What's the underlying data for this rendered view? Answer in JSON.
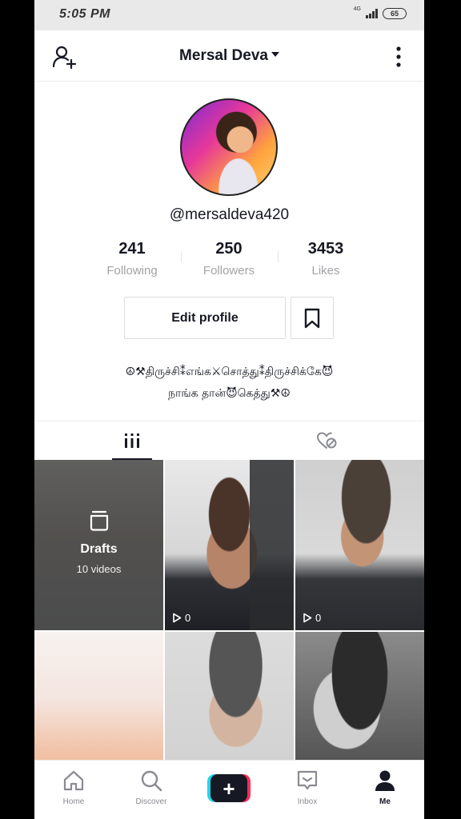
{
  "status_bar": {
    "time": "5:05 PM",
    "network": "4G",
    "battery": "65"
  },
  "header": {
    "title": "Mersal Deva"
  },
  "profile": {
    "handle": "@mersaldeva420",
    "stats": [
      {
        "value": "241",
        "label": "Following"
      },
      {
        "value": "250",
        "label": "Followers"
      },
      {
        "value": "3453",
        "label": "Likes"
      }
    ],
    "edit_label": "Edit profile",
    "bio_line1": "☮⚒திருச்சி⁑எங்க⚔சொத்து⁑திருச்சிக்கே😈",
    "bio_line2": "நாங்க தான்😈கெத்து⚒☮"
  },
  "grid": {
    "drafts_title": "Drafts",
    "drafts_count": "10 videos",
    "tiles": [
      {
        "views": "0"
      },
      {
        "views": "0"
      }
    ]
  },
  "bottom_nav": {
    "items": [
      {
        "label": "Home",
        "icon": "home-icon"
      },
      {
        "label": "Discover",
        "icon": "search-icon"
      },
      {
        "label": "",
        "icon": "plus-icon"
      },
      {
        "label": "Inbox",
        "icon": "inbox-icon"
      },
      {
        "label": "Me",
        "icon": "person-icon"
      }
    ]
  },
  "colors": {
    "accent_pink": "#fe2c55",
    "accent_cyan": "#20d5ec",
    "text_primary": "#161823",
    "text_secondary": "#a3a3a7"
  }
}
